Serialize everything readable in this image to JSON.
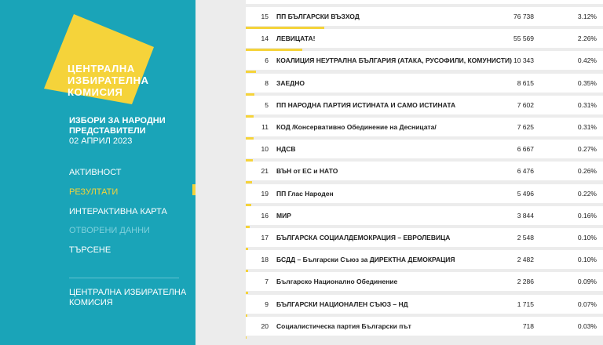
{
  "colors": {
    "sidebar_bg": "#1aa4b8",
    "accent": "#f5d33a",
    "disabled": "#7fd0dc",
    "content_bg": "#ececec"
  },
  "logo": {
    "lines": [
      "ЦЕНТРАЛНА",
      "ИЗБИРАТЕЛНА",
      "КОМИСИЯ"
    ]
  },
  "election": {
    "title_line1": "ИЗБОРИ ЗА НАРОДНИ",
    "title_line2": "ПРЕДСТАВИТЕЛИ",
    "date": "02 АПРИЛ 2023"
  },
  "nav": {
    "items": [
      {
        "label": "АКТИВНОСТ",
        "state": "normal"
      },
      {
        "label": "РЕЗУЛТАТИ",
        "state": "active"
      },
      {
        "label": "ИНТЕРАКТИВНА КАРТА",
        "state": "normal"
      },
      {
        "label": "ОТВОРЕНИ ДАННИ",
        "state": "disabled"
      },
      {
        "label": "ТЪРСЕНЕ",
        "state": "normal"
      }
    ]
  },
  "footer": {
    "line1": "ЦЕНТРАЛНА ИЗБИРАТЕЛНА",
    "line2": "КОМИСИЯ"
  },
  "results": [
    {
      "num": "15",
      "name": "ПП БЪЛГАРСКИ ВЪЗХОД",
      "votes": "76 738",
      "pct": "3.12%",
      "share": 0.0312
    },
    {
      "num": "14",
      "name": "ЛЕВИЦАТА!",
      "votes": "55 569",
      "pct": "2.26%",
      "share": 0.0226
    },
    {
      "num": "6",
      "name": "КОАЛИЦИЯ НЕУТРАЛНА БЪЛГАРИЯ (АТАКА, РУСОФИЛИ, КОМУНИСТИ)",
      "votes": "10 343",
      "pct": "0.42%",
      "share": 0.0042
    },
    {
      "num": "8",
      "name": "ЗАЕДНО",
      "votes": "8 615",
      "pct": "0.35%",
      "share": 0.0035
    },
    {
      "num": "5",
      "name": "ПП НАРОДНА ПАРТИЯ ИСТИНАТА И САМО ИСТИНАТА",
      "votes": "7 602",
      "pct": "0.31%",
      "share": 0.0031
    },
    {
      "num": "11",
      "name": "КОД /Консервативно Обединение на Десницата/",
      "votes": "7 625",
      "pct": "0.31%",
      "share": 0.0031
    },
    {
      "num": "10",
      "name": "НДСВ",
      "votes": "6 667",
      "pct": "0.27%",
      "share": 0.0027
    },
    {
      "num": "21",
      "name": "ВЪН от ЕС и НАТО",
      "votes": "6 476",
      "pct": "0.26%",
      "share": 0.0026
    },
    {
      "num": "19",
      "name": "ПП Глас Народен",
      "votes": "5 496",
      "pct": "0.22%",
      "share": 0.0022
    },
    {
      "num": "16",
      "name": "МИР",
      "votes": "3 844",
      "pct": "0.16%",
      "share": 0.0016
    },
    {
      "num": "17",
      "name": "БЪЛГАРСКА СОЦИАЛДЕМОКРАЦИЯ – ЕВРОЛЕВИЦА",
      "votes": "2 548",
      "pct": "0.10%",
      "share": 0.001
    },
    {
      "num": "18",
      "name": "БСДД – Български Съюз за ДИРЕКТНА ДЕМОКРАЦИЯ",
      "votes": "2 482",
      "pct": "0.10%",
      "share": 0.001
    },
    {
      "num": "7",
      "name": "Българско Национално Обединение",
      "votes": "2 286",
      "pct": "0.09%",
      "share": 0.0009
    },
    {
      "num": "9",
      "name": "БЪЛГАРСКИ НАЦИОНАЛЕН СЪЮЗ – НД",
      "votes": "1 715",
      "pct": "0.07%",
      "share": 0.0007
    },
    {
      "num": "20",
      "name": "Социалистическа партия Български път",
      "votes": "718",
      "pct": "0.03%",
      "share": 0.0003
    }
  ]
}
